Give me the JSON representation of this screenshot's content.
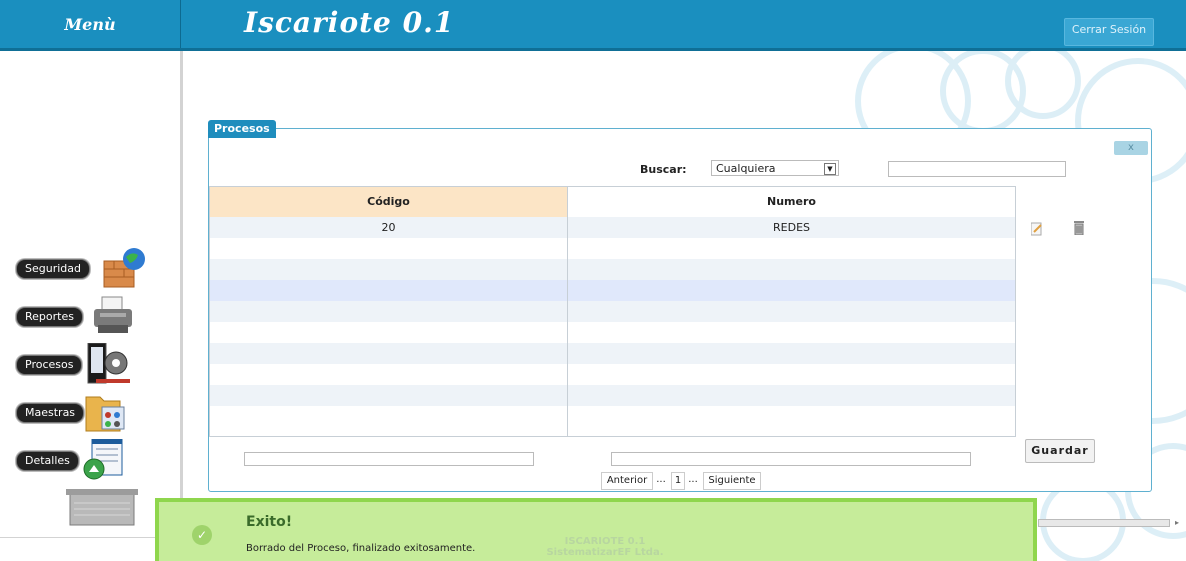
{
  "header": {
    "menu_title": "Menù",
    "app_title": "Iscariote 0.1",
    "logout_label": "Cerrar Sesión"
  },
  "sidebar": {
    "items": [
      {
        "label": "Seguridad",
        "icon": "firewall-globe-icon"
      },
      {
        "label": "Reportes",
        "icon": "printer-icon"
      },
      {
        "label": "Procesos",
        "icon": "process-gear-icon"
      },
      {
        "label": "Maestras",
        "icon": "folder-users-icon"
      },
      {
        "label": "Detalles",
        "icon": "window-list-icon"
      }
    ]
  },
  "panel": {
    "tab_label": "Procesos",
    "close_label": "x",
    "search_label": "Buscar:",
    "search_select_value": "Cualquiera",
    "search_input_value": "",
    "columns": [
      "Código",
      "Numero"
    ],
    "rows": [
      {
        "codigo": "20",
        "numero": "REDES"
      }
    ],
    "save_label": "Guardar",
    "pager": {
      "prev_label": "Anterior",
      "ellipsis_left": "...",
      "current_page": "1",
      "ellipsis_right": "...",
      "next_label": "Siguiente"
    }
  },
  "toast": {
    "title": "Exito!",
    "message": "Borrado del Proceso, finalizado exitosamente."
  },
  "footer": {
    "line1": "ISCARIOTE 0.1",
    "line2": "SistematizarEF Ltda."
  },
  "colors": {
    "header_bg": "#1a8fbf",
    "toast_bg": "#c6ec9a",
    "grid_header_bg": "#fce5c6"
  }
}
